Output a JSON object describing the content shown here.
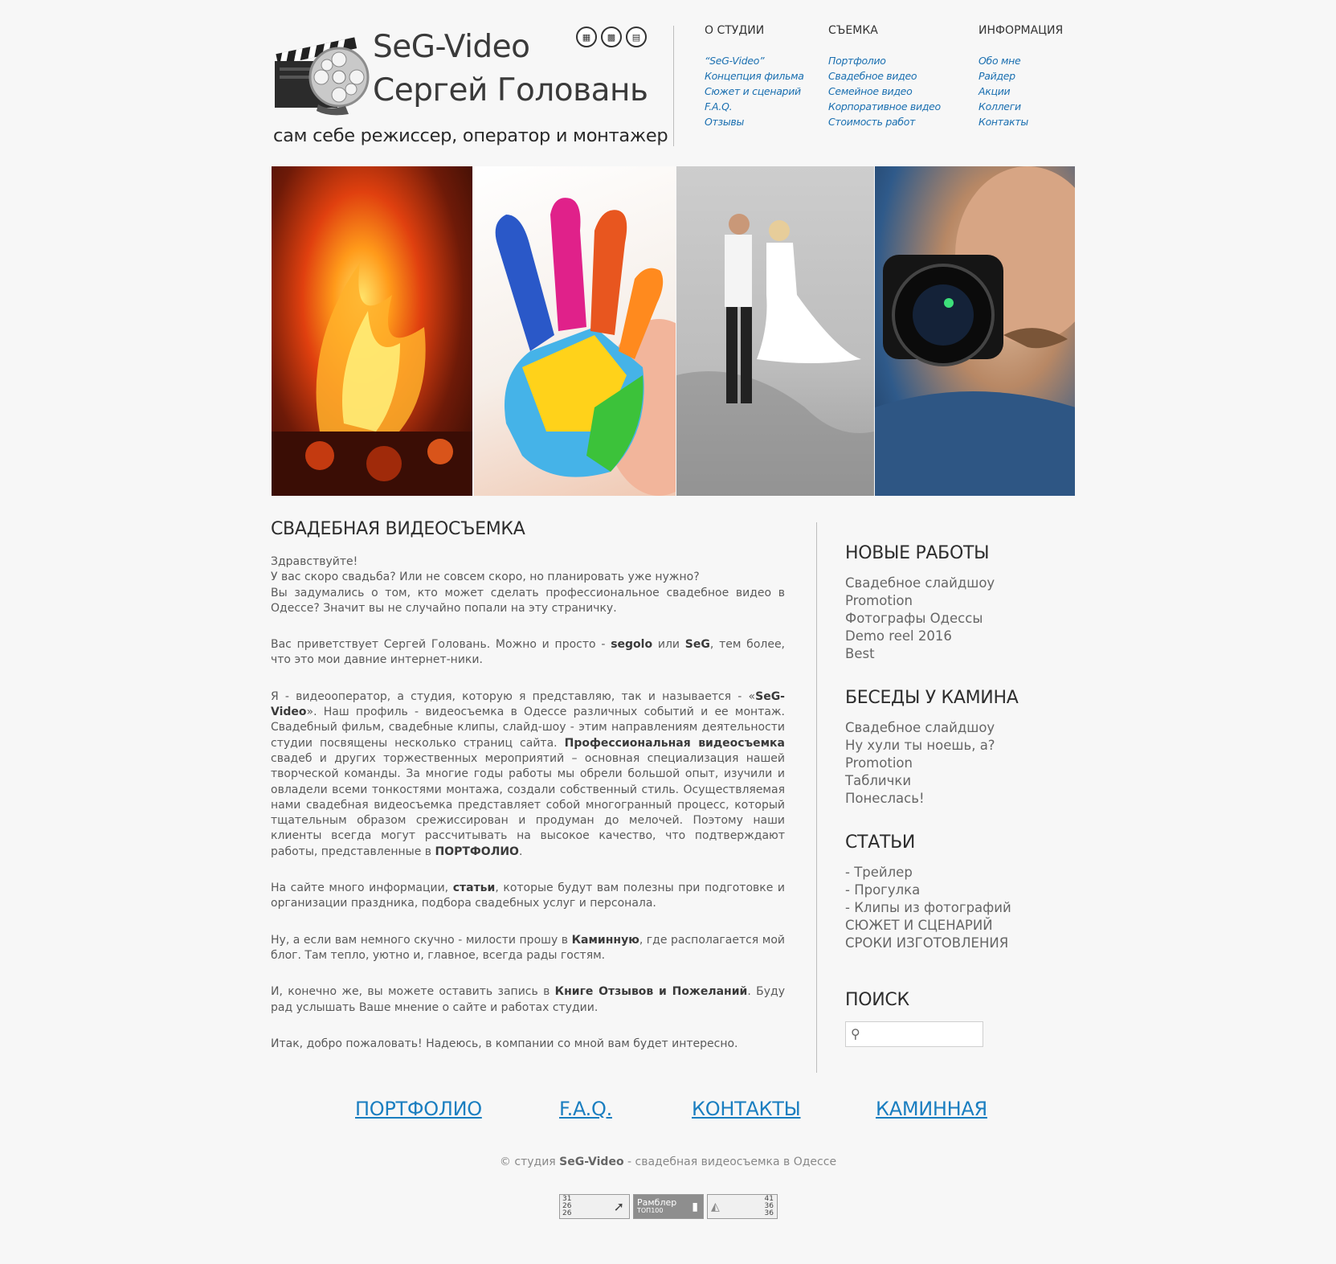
{
  "header": {
    "brand_line1": "SeG-Video",
    "brand_line2": "Сергей Головань",
    "tagline": "сам себе режиссер, оператор и монтажер",
    "social_icons": [
      "social-icon-1",
      "social-icon-2",
      "social-icon-3"
    ]
  },
  "nav": [
    {
      "title": "О СТУДИИ",
      "links": [
        "“SeG-Video”",
        "Концепция фильма",
        "Сюжет и сценарий",
        "F.A.Q.",
        "Отзывы"
      ]
    },
    {
      "title": "СЪЕМКА",
      "links": [
        "Портфолио",
        "Свадебное видео",
        "Семейное видео",
        "Корпоративное видео",
        "Стоимость работ"
      ]
    },
    {
      "title": "ИНФОРМАЦИЯ",
      "links": [
        "Обо мне",
        "Райдер",
        "Акции",
        "Коллеги",
        "Контакты"
      ]
    }
  ],
  "main": {
    "title": "СВАДЕБНАЯ ВИДЕОСЪЕМКА",
    "p1": [
      "Здравствуйте!",
      "У вас скоро свадьба? Или не совсем скоро, но планировать уже нужно?",
      "Вы задумались о том, кто может сделать профессиональное свадебное видео в Одессе? Значит вы не случайно попали на эту страничку."
    ],
    "p2": [
      "Вас приветствует Сергей Головань. Можно и просто - ",
      "segolo",
      " или ",
      "SeG",
      ", тем более, что это мои давние интернет-ники."
    ],
    "p3": [
      "Я - видеооператор, а студия, которую я представляю, так и называется - «",
      "SeG-Video",
      "». Наш профиль - видеосъемка в Одессе различных событий и ее монтаж. Свадебный фильм, свадебные клипы, слайд-шоу - этим направлениям деятельности студии посвящены несколько страниц сайта. ",
      "Профессиональная видеосъемка",
      " свадеб и других торжественных мероприятий – основная специализация нашей творческой команды. За многие годы работы мы обрели большой опыт, изучили и овладели всеми тонкостями монтажа, создали собственный стиль. Осуществляемая нами свадебная видеосъемка представляет собой многогранный процесс, который тщательным образом срежиссирован и продуман до мелочей. Поэтому наши клиенты всегда могут рассчитывать на высокое качество, что подтверждают работы, представленные в ",
      "ПОРТФОЛИО",
      "."
    ],
    "p4": [
      "На сайте много информации, ",
      "статьи",
      ", которые будут вам полезны при подготовке и организации праздника, подбора свадебных услуг и персонала."
    ],
    "p5": [
      "Ну, а если вам немного скучно - милости прошу в ",
      "Каминную",
      ", где располагается мой блог. Там тепло, уютно и, главное, всегда рады гостям."
    ],
    "p6": [
      "И, конечно же, вы можете оставить запись в ",
      "Книге Отзывов и Пожеланий",
      ". Буду рад услышать Ваше мнение о сайте и работах студии."
    ],
    "p7": "Итак, добро пожаловать! Надеюсь, в компании со мной вам будет интересно."
  },
  "sidebar": {
    "new_works": {
      "title": "НОВЫЕ РАБОТЫ",
      "links": [
        "Свадебное слайдшоу",
        "Promotion",
        "Фотографы Одессы",
        "Demo reel 2016",
        "Best"
      ]
    },
    "talks": {
      "title": "БЕСЕДЫ У КАМИНА",
      "links": [
        "Свадебное слайдшоу",
        "Ну хули ты ноешь, а?",
        "Promotion",
        "Таблички",
        "Понеслась!"
      ]
    },
    "articles": {
      "title": "СТАТЬИ",
      "links": [
        "- Трейлер",
        "- Прогулка",
        "- Клипы из фотографий",
        "СЮЖЕТ И СЦЕНАРИЙ",
        "СРОКИ ИЗГОТОВЛЕНИЯ"
      ]
    },
    "search": {
      "title": "ПОИСК",
      "placeholder": "",
      "value": ""
    }
  },
  "footer": {
    "links": [
      "ПОРТФОЛИО",
      "F.A.Q.",
      "КОНТАКТЫ",
      "КАМИННАЯ"
    ],
    "copyright_prefix": "© студия ",
    "copyright_brand": "SeG-Video",
    "copyright_suffix": " - свадебная видеосъемка в Одессе",
    "counter1": [
      "31",
      "26",
      "26"
    ],
    "counter2": [
      "Рамблер",
      "ТОП100"
    ],
    "counter3": [
      "41",
      "36",
      "36"
    ]
  },
  "colors": {
    "link": "#1a6fb0",
    "footer_link": "#1a7ec0",
    "text": "#5a5a5a",
    "heading": "#2d2d2d",
    "background": "#f7f7f7"
  }
}
